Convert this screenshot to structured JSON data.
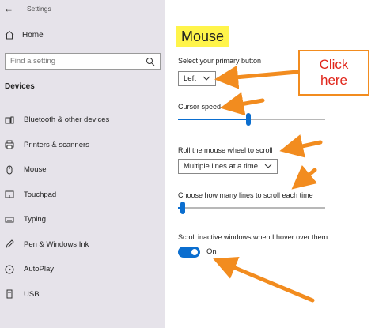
{
  "window": {
    "back_glyph": "←",
    "title": "Settings"
  },
  "sidebar": {
    "home_label": "Home",
    "search_placeholder": "Find a setting",
    "section": "Devices",
    "items": [
      {
        "label": "Bluetooth & other devices",
        "icon": "bluetooth-icon"
      },
      {
        "label": "Printers & scanners",
        "icon": "printer-icon"
      },
      {
        "label": "Mouse",
        "icon": "mouse-icon"
      },
      {
        "label": "Touchpad",
        "icon": "touchpad-icon"
      },
      {
        "label": "Typing",
        "icon": "keyboard-icon"
      },
      {
        "label": "Pen & Windows Ink",
        "icon": "pen-icon"
      },
      {
        "label": "AutoPlay",
        "icon": "autoplay-icon"
      },
      {
        "label": "USB",
        "icon": "usb-icon"
      }
    ]
  },
  "main": {
    "title": "Mouse",
    "primary_button": {
      "label": "Select your primary button",
      "value": "Left"
    },
    "cursor_speed": {
      "label": "Cursor speed",
      "level": 0.48
    },
    "scroll": {
      "label": "Roll the mouse wheel to scroll",
      "value": "Multiple lines at a time"
    },
    "lines": {
      "label": "Choose how many lines to scroll each time",
      "level": 0.03
    },
    "inactive": {
      "label": "Scroll inactive windows when I hover over them",
      "state": "On"
    }
  },
  "annotation": {
    "callout_line1": "Click",
    "callout_line2": "here"
  },
  "colors": {
    "accent": "#0b6ecf",
    "highlight": "#fff44a",
    "arrow": "#f28c1f",
    "callout_text": "#e0261b"
  }
}
